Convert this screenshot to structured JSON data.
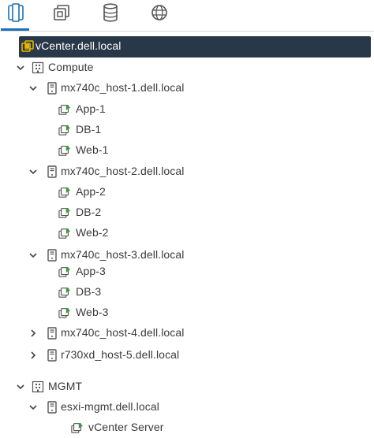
{
  "tabs": [
    {
      "name": "hosts-and-clusters",
      "active": true
    },
    {
      "name": "vms-and-templates",
      "active": false
    },
    {
      "name": "storage",
      "active": false
    },
    {
      "name": "networking",
      "active": false
    }
  ],
  "tree": {
    "root": {
      "label": "vCenter.dell.local",
      "expanded": true,
      "selected": true
    },
    "datacenters": [
      {
        "label": "Compute",
        "expanded": true,
        "hosts": [
          {
            "label": "mx740c_host-1.dell.local",
            "expanded": true,
            "vms": [
              "App-1",
              "DB-1",
              "Web-1"
            ]
          },
          {
            "label": "mx740c_host-2.dell.local",
            "expanded": true,
            "vms": [
              "App-2",
              "DB-2",
              "Web-2"
            ]
          },
          {
            "label": "mx740c_host-3.dell.local",
            "expanded": true,
            "vms": [
              "App-3",
              "DB-3",
              "Web-3"
            ]
          },
          {
            "label": "mx740c_host-4.dell.local",
            "expanded": false,
            "vms": []
          },
          {
            "label": "r730xd_host-5.dell.local",
            "expanded": false,
            "vms": []
          }
        ]
      },
      {
        "label": "MGMT",
        "expanded": true,
        "hosts": [
          {
            "label": "esxi-mgmt.dell.local",
            "expanded": true,
            "vms": [
              "vCenter Server"
            ]
          }
        ]
      }
    ]
  },
  "colors": {
    "accent": "#1b6fb5",
    "selection": "#283849",
    "vm_green": "#3c9a3c",
    "vcenter_yellow": "#e8b400"
  }
}
